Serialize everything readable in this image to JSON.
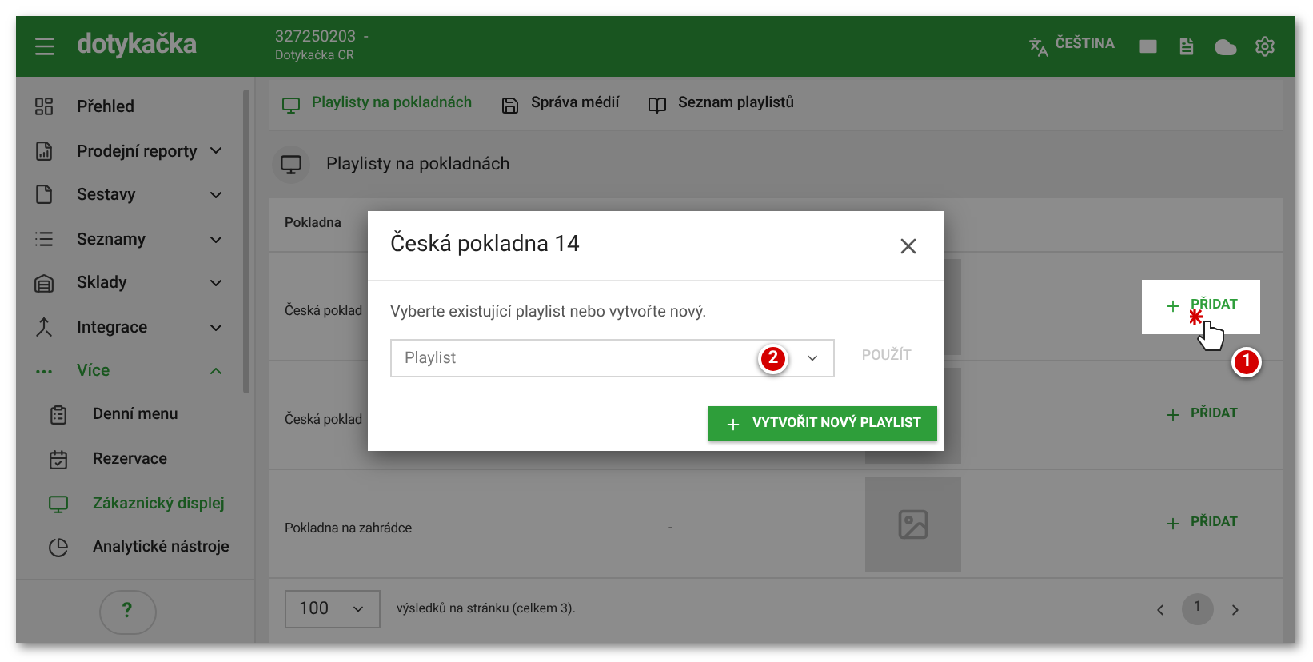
{
  "header": {
    "logo": "dotykačka",
    "account_id": "327250203  -",
    "account_name": "Dotykačka CR",
    "language": "ČEŠTINA"
  },
  "sidebar": {
    "items": [
      {
        "label": "Přehled",
        "kind": "link",
        "selected": false
      },
      {
        "label": "Prodejní reporty",
        "kind": "group",
        "selected": false,
        "expanded": false
      },
      {
        "label": "Sestavy",
        "kind": "group",
        "selected": false,
        "expanded": false
      },
      {
        "label": "Seznamy",
        "kind": "group",
        "selected": false,
        "expanded": false
      },
      {
        "label": "Sklady",
        "kind": "group",
        "selected": false,
        "expanded": false
      },
      {
        "label": "Integrace",
        "kind": "group",
        "selected": false,
        "expanded": false
      },
      {
        "label": "Více",
        "kind": "group",
        "selected": true,
        "expanded": true,
        "children": [
          {
            "label": "Denní menu",
            "selected": false
          },
          {
            "label": "Rezervace",
            "selected": false
          },
          {
            "label": "Zákaznický displej",
            "selected": true
          },
          {
            "label": "Analytické nástroje",
            "selected": false
          }
        ]
      }
    ],
    "help": "?"
  },
  "tabs": [
    {
      "label": "Playlisty na pokladnách",
      "selected": true
    },
    {
      "label": "Správa médií",
      "selected": false
    },
    {
      "label": "Seznam playlistů",
      "selected": false
    }
  ],
  "page_title": "Playlisty na pokladnách",
  "table": {
    "columns": [
      "Pokladna"
    ],
    "rows": [
      {
        "cells": [
          "Česká poklad"
        ],
        "add": "PŘIDAT",
        "highlighted": true
      },
      {
        "cells": [
          "Česká poklad"
        ],
        "add": "PŘIDAT",
        "highlighted": false
      },
      {
        "cells": [
          "Pokladna na zahrádce",
          "-"
        ],
        "add": "PŘIDAT",
        "highlighted": false
      }
    ]
  },
  "pagination": {
    "rows_per_page": "100",
    "summary": "výsledků na stránku (celkem 3).",
    "pages": [
      {
        "label": "1",
        "selected": true
      }
    ]
  },
  "dialog": {
    "title": "Česká pokladna 14",
    "text": "Vyberte existující playlist nebo vytvořte nový.",
    "select_placeholder": "Playlist",
    "apply": {
      "label": "POUŽÍT",
      "disabled": true
    },
    "create": "VYTVOŘIT NOVÝ PLAYLIST"
  },
  "annotations": [
    "2",
    "1"
  ]
}
